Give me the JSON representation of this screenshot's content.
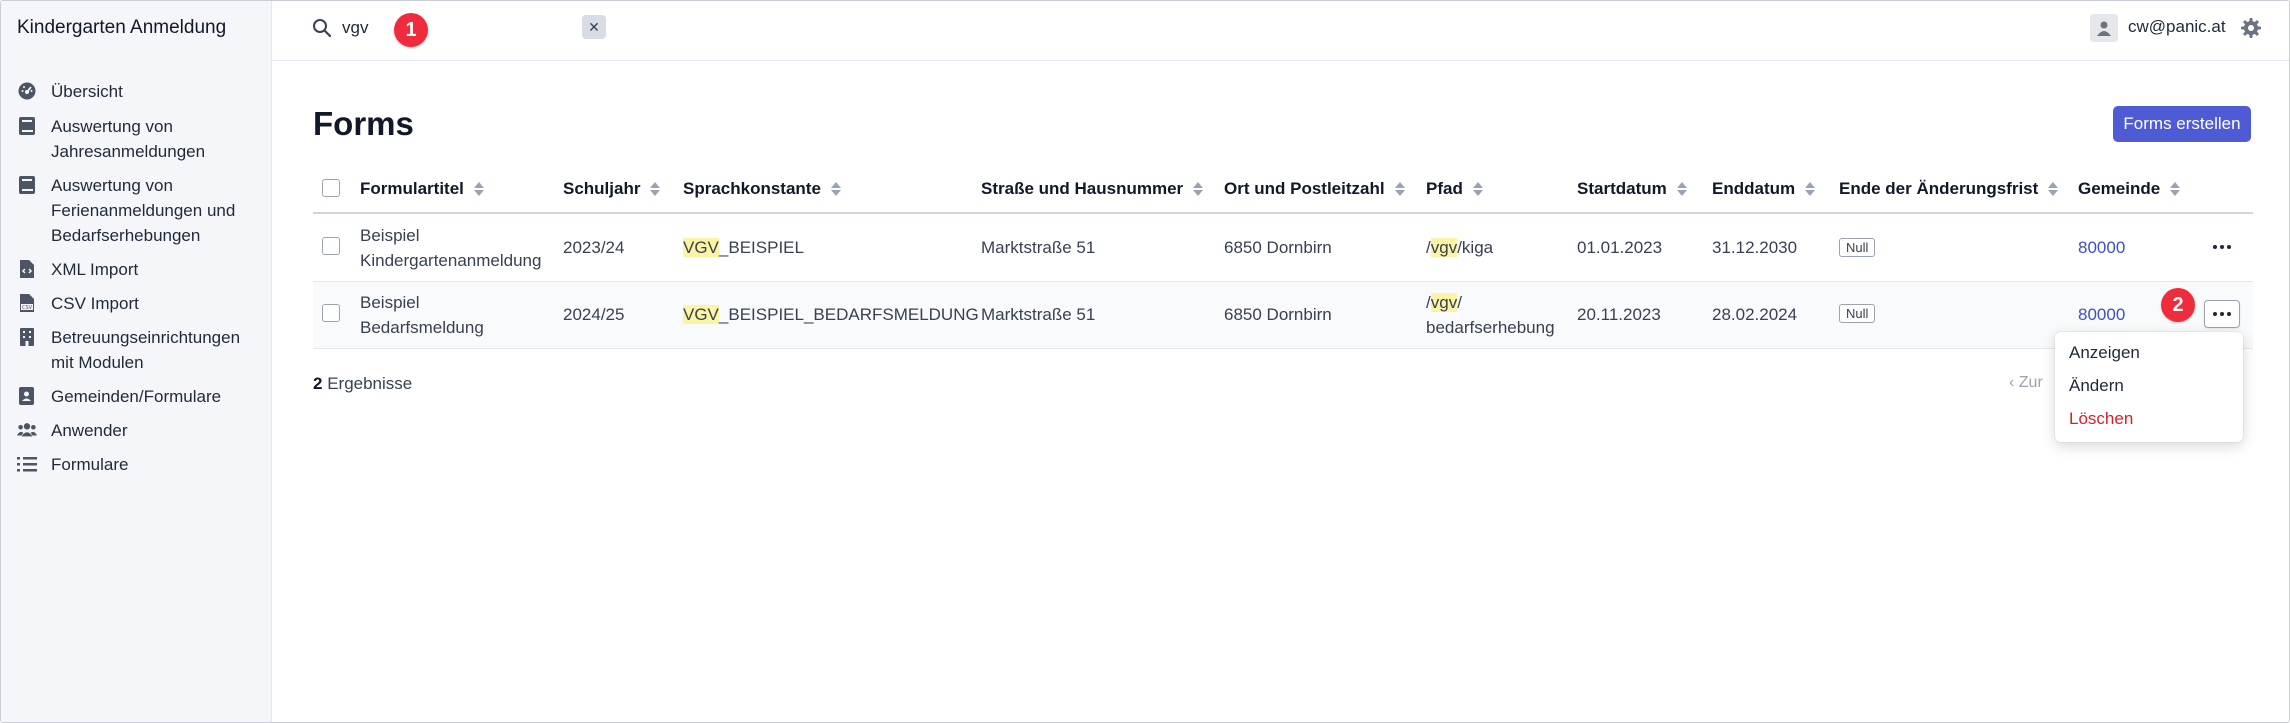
{
  "app": {
    "title": "Kindergarten Anmeldung"
  },
  "sidebar": {
    "items": [
      {
        "label": "Übersicht",
        "icon": "dashboard-icon"
      },
      {
        "label": "Auswertung von Jahresanmeldungen",
        "icon": "book-icon"
      },
      {
        "label": "Auswertung von Ferienanmeldungen und Bedarfserhebungen",
        "icon": "book-icon"
      },
      {
        "label": "XML Import",
        "icon": "file-code-icon"
      },
      {
        "label": "CSV Import",
        "icon": "file-csv-icon"
      },
      {
        "label": "Betreuungseinrichtungen mit Modulen",
        "icon": "building-icon"
      },
      {
        "label": "Gemeinden/Formulare",
        "icon": "address-book-icon"
      },
      {
        "label": "Anwender",
        "icon": "users-icon"
      },
      {
        "label": "Formulare",
        "icon": "list-icon"
      }
    ]
  },
  "topbar": {
    "search_value": "vgv",
    "clear_label": "✕",
    "user_email": "cw@panic.at"
  },
  "markers": {
    "one": "1",
    "two": "2"
  },
  "page": {
    "title": "Forms",
    "create_label": "Forms erstellen"
  },
  "table": {
    "columns": [
      "Formulartitel",
      "Schuljahr",
      "Sprachkonstante",
      "Straße und Hausnummer",
      "Ort und Postleitzahl",
      "Pfad",
      "Startdatum",
      "Enddatum",
      "Ende der Änderungsfrist",
      "Gemeinde"
    ],
    "rows": [
      {
        "title_line1": "Beispiel",
        "title_line2": "Kindergartenanmeldung",
        "schuljahr": "2023/24",
        "sprach_hl": "VGV",
        "sprach_rest": "_BEISPIEL",
        "strasse": "Marktstraße 51",
        "ort": "6850 Dornbirn",
        "pfad_pre": "/",
        "pfad_hl": "vgv",
        "pfad_post": "/kiga",
        "pfad_line2": "",
        "start": "01.01.2023",
        "end": "31.12.2030",
        "frist": "Null",
        "gemeinde": "80000"
      },
      {
        "title_line1": "Beispiel",
        "title_line2": "Bedarfsmeldung",
        "schuljahr": "2024/25",
        "sprach_hl": "VGV",
        "sprach_rest": "_BEISPIEL_BEDARFSMELDUNG",
        "strasse": "Marktstraße 51",
        "ort": "6850 Dornbirn",
        "pfad_pre": "/",
        "pfad_hl": "vgv",
        "pfad_post": "/",
        "pfad_line2": "bedarfserhebung",
        "start": "20.11.2023",
        "end": "28.02.2024",
        "frist": "Null",
        "gemeinde": "80000"
      }
    ]
  },
  "footer": {
    "results_count": "2",
    "results_label": " Ergebnisse",
    "prev_label": "‹  Zur"
  },
  "row_menu": {
    "items": [
      "Anzeigen",
      "Ändern",
      "Löschen"
    ]
  },
  "colors": {
    "accent": "#4f5bd5",
    "danger": "#d2232a",
    "highlight": "#fbf5a3",
    "marker": "#ef2b3c"
  }
}
